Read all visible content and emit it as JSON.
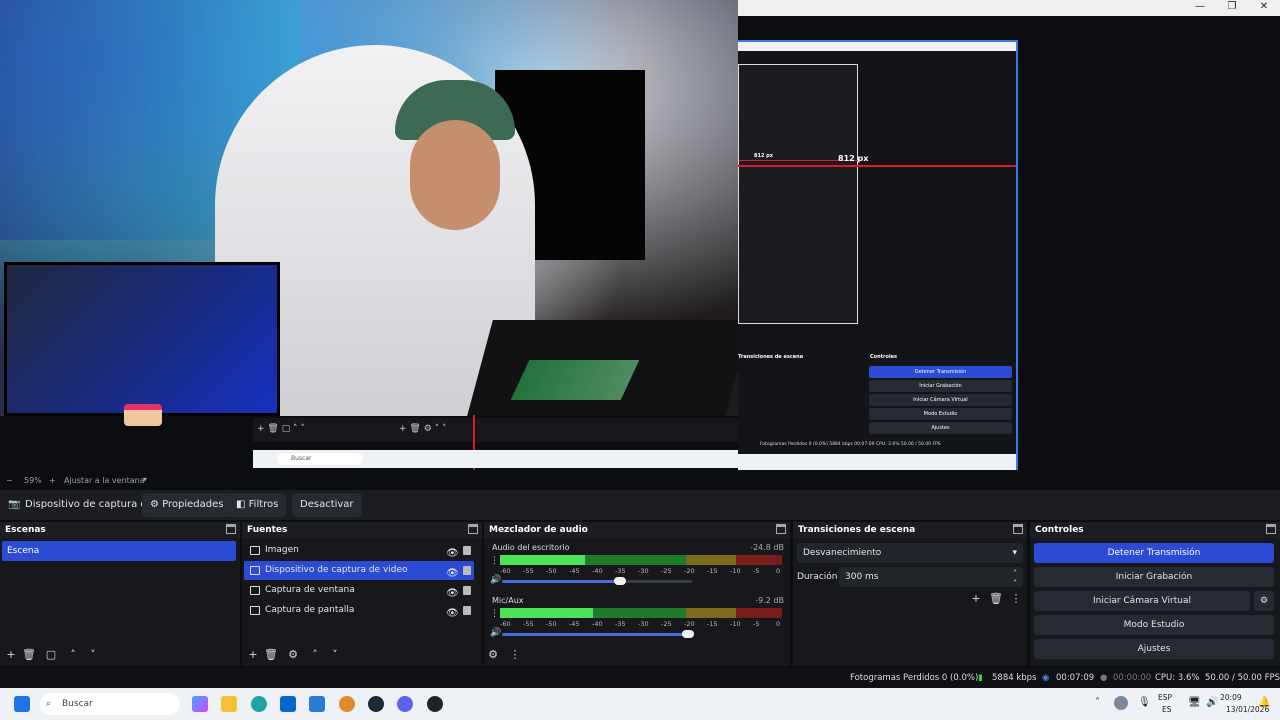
{
  "preview": {
    "nested_label": "812 px",
    "nested_mini_label": "812 px",
    "nested_transitions_title": "Transiciones de escena",
    "nested_controls_title": "Controles",
    "nested_buttons": [
      "Detener Transmisión",
      "Iniciar Grabación",
      "Iniciar Cámara Virtual",
      "Modo Estudio",
      "Ajustes"
    ],
    "nested_status": "Fotogramas Perdidos 0 (0.0%)   5884 kbps   00:07:09   CPU: 3.6%   50.00 / 50.00 FPS",
    "nested_search": "Buscar"
  },
  "zoom": {
    "minus": "−",
    "value": "59%",
    "plus": "+",
    "fit_label": "Ajustar a la ventana"
  },
  "source_toolbar": {
    "selected_source": "Dispositivo de captura de v",
    "properties": "Propiedades",
    "filters": "Filtros",
    "deactivate": "Desactivar"
  },
  "scenes": {
    "title": "Escenas",
    "items": [
      "Escena"
    ]
  },
  "sources": {
    "title": "Fuentes",
    "items": [
      {
        "label": "Imagen",
        "selected": false
      },
      {
        "label": "Dispositivo de captura de video",
        "selected": true
      },
      {
        "label": "Captura de ventana",
        "selected": false
      },
      {
        "label": "Captura de pantalla",
        "selected": false
      }
    ]
  },
  "mixer": {
    "title": "Mezclador de audio",
    "channels": [
      {
        "name": "Audio del escritorio",
        "db": "-24.8 dB",
        "level": 0.3,
        "volume": 0.62
      },
      {
        "name": "Mic/Aux",
        "db": "-9.2 dB",
        "level": 0.33,
        "volume": 0.98
      }
    ],
    "scale": [
      "-60",
      "-55",
      "-50",
      "-45",
      "-40",
      "-35",
      "-30",
      "-25",
      "-20",
      "-15",
      "-10",
      "-5",
      "0"
    ]
  },
  "transitions": {
    "title": "Transiciones de escena",
    "selected": "Desvanecimiento",
    "duration_label": "Duración",
    "duration_value": "300 ms"
  },
  "controls": {
    "title": "Controles",
    "buttons": [
      "Detener Transmisión",
      "Iniciar Grabación",
      "Iniciar Cámara Virtual",
      "Modo Estudio",
      "Ajustes"
    ]
  },
  "status": {
    "dropped": "Fotogramas Perdidos 0 (0.0%)",
    "bitrate": "5884 kbps",
    "stream_time": "00:07:09",
    "rec_time": "00:00:00",
    "cpu": "CPU: 3.6%",
    "fps": "50.00 / 50.00 FPS"
  },
  "taskbar": {
    "search_placeholder": "Buscar",
    "lang_top": "ESP",
    "lang_bottom": "ES",
    "time": "20:09",
    "date": "13/01/2026"
  },
  "colors": {
    "accent": "#2c4bd4",
    "capture_border": "#3a78f0",
    "marker_red": "#e0162b"
  }
}
